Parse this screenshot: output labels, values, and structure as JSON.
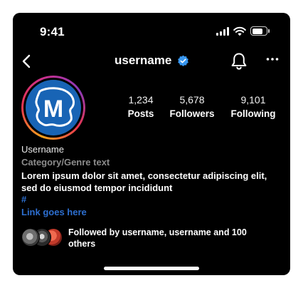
{
  "status_bar": {
    "time": "9:41"
  },
  "nav": {
    "title": "username"
  },
  "stats": [
    {
      "count": "1,234",
      "label": "Posts"
    },
    {
      "count": "5,678",
      "label": "Followers"
    },
    {
      "count": "9,101",
      "label": "Following"
    }
  ],
  "bio": {
    "name": "Username",
    "category": "Category/Genre text",
    "text": "Lorem ipsum dolor sit amet, consectetur adipiscing elit, sed do eiusmod tempor incididunt",
    "hashtag": "#",
    "link": "Link goes here"
  },
  "followed_by": {
    "text": "Followed by username, username and 100 others"
  },
  "avatar": {
    "letter": "M"
  },
  "colors": {
    "background": "#000000",
    "link": "#2d6fd0",
    "verified": "#3897f0",
    "avatar_fill": "#1864b5",
    "secondary_text": "#8c8c8c"
  },
  "icons": [
    "back-chevron-icon",
    "verified-badge-icon",
    "bell-icon",
    "more-horizontal-icon",
    "signal-icon",
    "wifi-icon",
    "battery-icon"
  ]
}
